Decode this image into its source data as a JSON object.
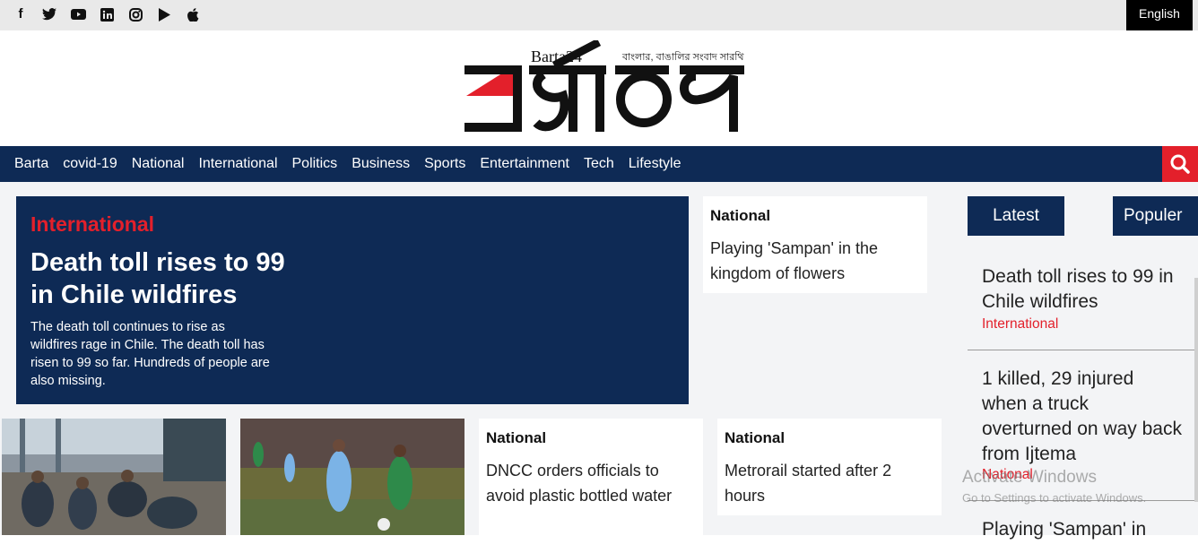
{
  "topbar": {
    "social_icons": [
      "facebook-icon",
      "twitter-icon",
      "youtube-icon",
      "linkedin-icon",
      "instagram-icon",
      "google-play-icon",
      "apple-icon"
    ],
    "language": "English"
  },
  "logo": {
    "wordmark": "বার্তা২৪",
    "latin": "Barta24",
    "tagline": "বাংলার, বাঙালির সংবাদ সারথি"
  },
  "nav": {
    "items": [
      "Barta",
      "covid-19",
      "National",
      "International",
      "Politics",
      "Business",
      "Sports",
      "Entertainment",
      "Tech",
      "Lifestyle"
    ]
  },
  "hero": {
    "category": "International",
    "title": "Death toll rises to 99 in Chile wildfires",
    "description": "The death toll continues to rise as wildfires rage in Chile. The death toll has risen to 99 so far. Hundreds of people are also missing."
  },
  "cards": [
    {
      "category": "National",
      "title": "Playing 'Sampan' in the kingdom of flowers"
    },
    {
      "category": "National",
      "title": "DNCC orders officials to avoid plastic bottled water"
    },
    {
      "category": "National",
      "title": "Metrorail started after 2 hours"
    }
  ],
  "sidebar": {
    "tabs": [
      "Latest",
      "Populer"
    ],
    "latest": [
      {
        "title": "Death toll rises to 99 in Chile wildfires",
        "category": "International"
      },
      {
        "title": "1 killed, 29 injured when a truck overturned on way back from Ijtema",
        "category": "National"
      },
      {
        "title": "Playing 'Sampan' in"
      }
    ]
  },
  "watermark": {
    "line1": "Activate Windows",
    "line2": "Go to Settings to activate Windows."
  },
  "colors": {
    "navy": "#0e2a55",
    "red": "#e3202b",
    "topbar": "#e9e9e9"
  }
}
